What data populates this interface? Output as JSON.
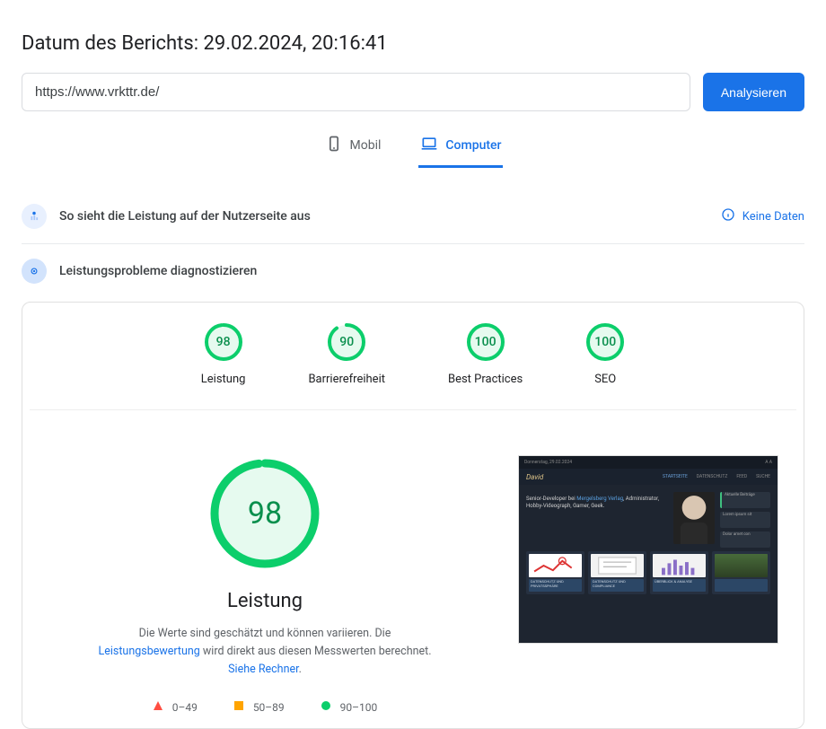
{
  "report_date_label": "Datum des Berichts: 29.02.2024, 20:16:41",
  "url_value": "https://www.vrkttr.de/",
  "analyze_label": "Analysieren",
  "tabs": {
    "mobile": "Mobil",
    "desktop": "Computer"
  },
  "section_user": "So sieht die Leistung auf der Nutzerseite aus",
  "no_data_label": "Keine Daten",
  "section_diagnose": "Leistungsprobleme diagnostizieren",
  "scores": [
    {
      "value": 98,
      "label": "Leistung"
    },
    {
      "value": 90,
      "label": "Barrierefreiheit"
    },
    {
      "value": 100,
      "label": "Best Practices"
    },
    {
      "value": 100,
      "label": "SEO"
    }
  ],
  "main_score": {
    "value": 98,
    "label": "Leistung"
  },
  "perf_desc": {
    "pre": "Die Werte sind geschätzt und können variieren. Die ",
    "link1": "Leistungsbewertung",
    "mid": " wird direkt aus diesen Messwerten berechnet. ",
    "link2": "Siehe Rechner"
  },
  "legend": {
    "bad": "0–49",
    "mid": "50–89",
    "good": "90–100"
  },
  "preview": {
    "logo": "David",
    "nav": [
      "STARTSEITE",
      "DATENSCHUTZ",
      "FEED",
      "SUCHE"
    ],
    "hero_pre": "Senior-Developer bei ",
    "hero_link": "Mergelsberg Verlag",
    "hero_post": ", Administrator, Hobby-Videograph, Gamer, Geek.",
    "side_title": "Aktuelle Beiträge",
    "cards": [
      "DATENSCHUTZ UND PRIVATSSPHÄRE",
      "DATENSCHUTZ UND COMPLIANCE",
      "ÜBERBLICK & ANALYSE"
    ]
  },
  "colors": {
    "good": "#0cce6b",
    "accent": "#1a73e8",
    "bad": "#ff4e42",
    "mid": "#ffa400"
  }
}
